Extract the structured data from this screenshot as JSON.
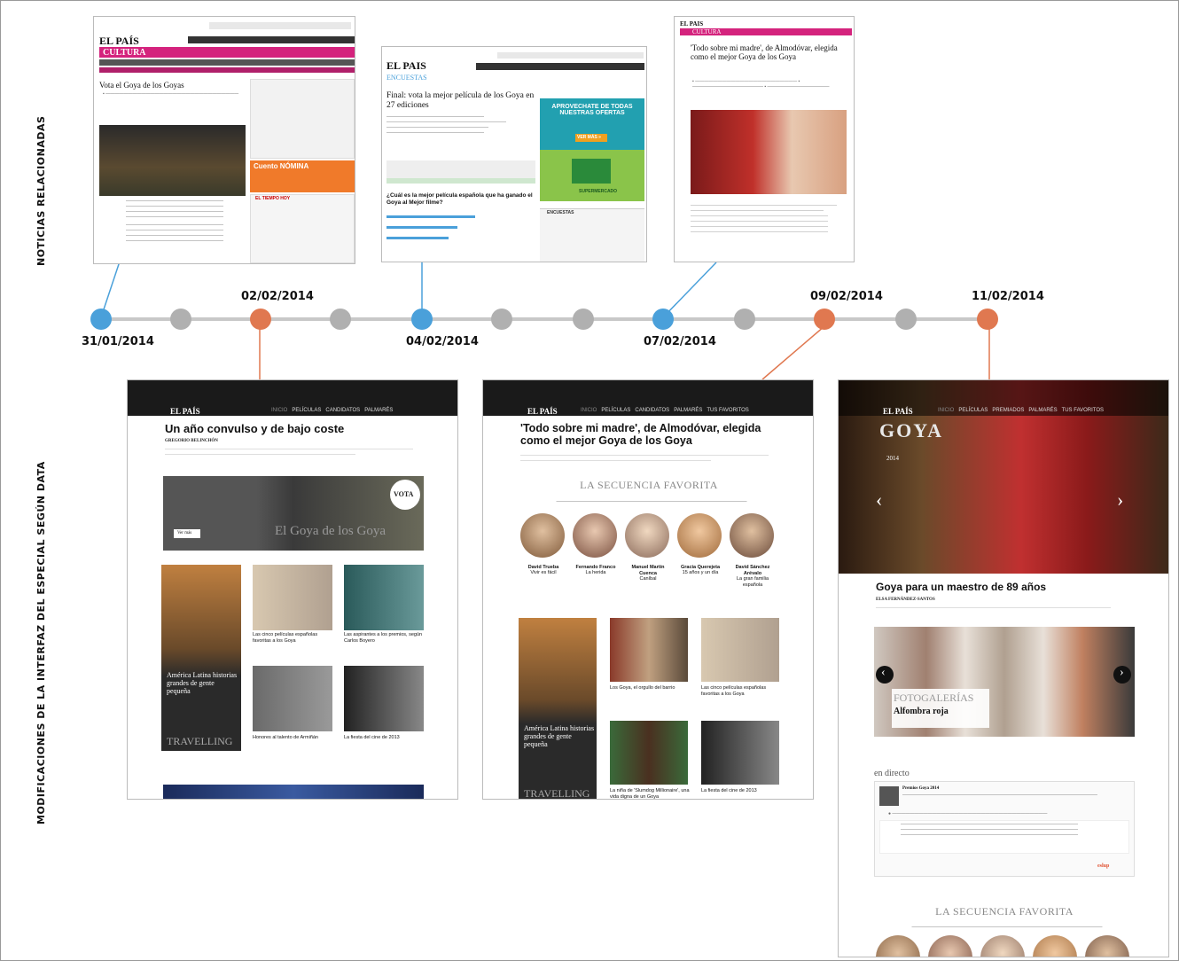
{
  "labels": {
    "side_top": "NOTICIAS RELACIONADAS",
    "side_bottom": "MODIFICACIONES DE LA INTERFAZ DEL ESPECIAL SEGÚN DATA"
  },
  "colors": {
    "blue": "#4aa0da",
    "orange": "#e07850",
    "grey": "#b0b0b0",
    "line": "#c8c8c8"
  },
  "timeline": {
    "dates": [
      {
        "text": "31/01/2014",
        "color": "blue"
      },
      {
        "text": "02/02/2014",
        "color": "orange"
      },
      {
        "text": "04/02/2014",
        "color": "blue"
      },
      {
        "text": "07/02/2014",
        "color": "blue"
      },
      {
        "text": "09/02/2014",
        "color": "orange"
      },
      {
        "text": "11/02/2014",
        "color": "orange"
      }
    ]
  },
  "news1": {
    "logo": "EL PAÍS",
    "section": "CULTURA",
    "headline": "Vota el Goya de los Goyas",
    "promo": "Cuento NÓMINA",
    "widget": "EL TIEMPO HOY"
  },
  "news2": {
    "logo": "EL PAIS",
    "section": "ENCUESTAS",
    "headline": "Final: vota la mejor película de los Goya en 27 ediciones",
    "ad1": "APROVECHATE DE TODAS NUESTRAS OFERTAS",
    "ad_button": "VER MÁS »",
    "ad2": "SUPERMERCADO",
    "question": "¿Cuál es la mejor película española que ha ganado el Goya al Mejor filme?",
    "sidebar": "ENCUESTAS"
  },
  "news3": {
    "logo": "EL PAIS",
    "section": "CULTURA",
    "headline": "'Todo sobre mi madre', de Almodóvar, elegida como el mejor Goya de los Goya"
  },
  "redesign1": {
    "logo": "EL PAÍS",
    "nav": [
      "INICIO",
      "PELÍCULAS",
      "CANDIDATOS",
      "PALMARÉS"
    ],
    "title": "Un año convulso y de bajo coste",
    "author": "GREGORIO BELINCHÓN",
    "banner_button": "Ver más",
    "banner_badge": "VOTA",
    "banner_title": "El Goya de los Goya",
    "side_card_title": "América Latina historias grandes de gente pequeña",
    "side_card_footer": "TRAVELLING",
    "cards": [
      "Las cinco películas españolas favoritas a los Goya",
      "Las aspirantes a los premios, según Carlos Boyero",
      "Honores al talento de Armiñán",
      "La fiesta del cine de 2013"
    ]
  },
  "redesign2": {
    "logo": "EL PAÍS",
    "nav": [
      "INICIO",
      "PELÍCULAS",
      "CANDIDATOS",
      "PALMARÉS",
      "TUS FAVORITOS"
    ],
    "title": "'Todo sobre mi madre', de Almodóvar, elegida como el mejor Goya de los Goya",
    "section": "LA SECUENCIA FAVORITA",
    "directors": [
      {
        "name": "David Trueba",
        "film": "Vivir es fácil"
      },
      {
        "name": "Fernando Franco",
        "film": "La herida"
      },
      {
        "name": "Manuel Martín Cuenca",
        "film": "Caníbal"
      },
      {
        "name": "Gracia Querejeta",
        "film": "15 años y un día"
      },
      {
        "name": "David Sánchez Arévalo",
        "film": "La gran familia española"
      }
    ],
    "side_card_title": "América Latina historias grandes de gente pequeña",
    "side_card_footer": "TRAVELLING",
    "cards": [
      "Los Goya, el orgullo del barrio",
      "Las cinco películas españolas favoritas a los Goya",
      "La niña de 'Slumdog Millionaire', una vida digna de un Goya",
      "La fiesta del cine de 2013"
    ]
  },
  "redesign3": {
    "logo": "EL PAÍS",
    "nav": [
      "INICIO",
      "PELÍCULAS",
      "PREMIADOS",
      "PALMARÉS",
      "TUS FAVORITOS"
    ],
    "hero_badge": "GOYA",
    "hero_year": "2014",
    "title": "Goya para un maestro de 89 años",
    "author": "ELSA FERNÁNDEZ-SANTOS",
    "gallery_kicker": "FOTOGALERÍAS",
    "gallery_title": "Alfombra roja",
    "live_label": "en directo",
    "live_item": "Premios Goya 2014",
    "live_brand": "eslup",
    "section": "LA SECUENCIA FAVORITA"
  }
}
